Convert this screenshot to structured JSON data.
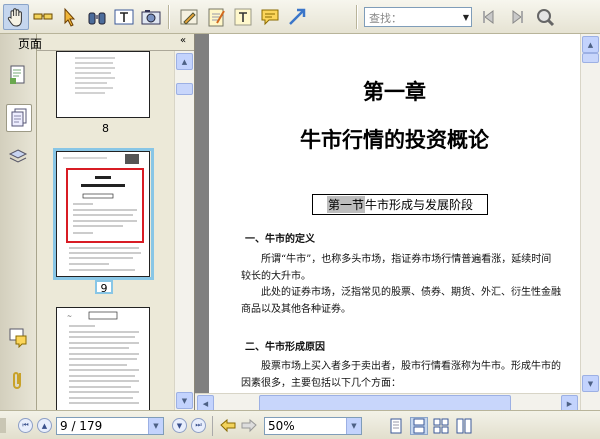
{
  "toolbar": {
    "tools": [
      {
        "name": "hand-tool-icon"
      },
      {
        "name": "glasses-icon"
      },
      {
        "name": "select-arrow-icon"
      },
      {
        "name": "binoculars-icon"
      },
      {
        "name": "text-select-icon"
      },
      {
        "name": "snapshot-camera-icon"
      },
      {
        "name": "pencil-edit-icon"
      },
      {
        "name": "note-pad-icon"
      },
      {
        "name": "text-box-icon"
      },
      {
        "name": "comment-bubble-icon"
      },
      {
        "name": "arrow-line-icon"
      }
    ],
    "search_label": "查找：",
    "search_value": ""
  },
  "side_panel": {
    "title": "页面",
    "close_glyph": "«"
  },
  "thumbnails": [
    {
      "label": "8"
    },
    {
      "label": "9",
      "selected": true
    },
    {
      "label": ""
    }
  ],
  "document": {
    "chapter": "第一章",
    "chapter_title": "牛市行情的投资概论",
    "section_title_highlight": "第一节",
    "section_title_rest": "牛市形成与发展阶段",
    "heading_1": "一、牛市的定义",
    "para_1": "所谓“牛市”，也称多头市场，指证券市场行情普遍看涨，延续时间较长的大升市。",
    "para_2": "此处的证券市场，泛指常见的股票、债券、期货、外汇、衍生性金融商品以及其他各种证券。",
    "heading_2": "二、牛市形成原因",
    "para_3": "股票市场上买入者多于卖出者，股市行情看涨称为牛市。形成牛市的因素很多，主要包括以下几个方面："
  },
  "status": {
    "page_text": "9 / 179",
    "zoom": "50%"
  },
  "colors": {
    "selected_thumb_border": "#88c6e6",
    "thumb_highlight_red": "#d81c24"
  }
}
